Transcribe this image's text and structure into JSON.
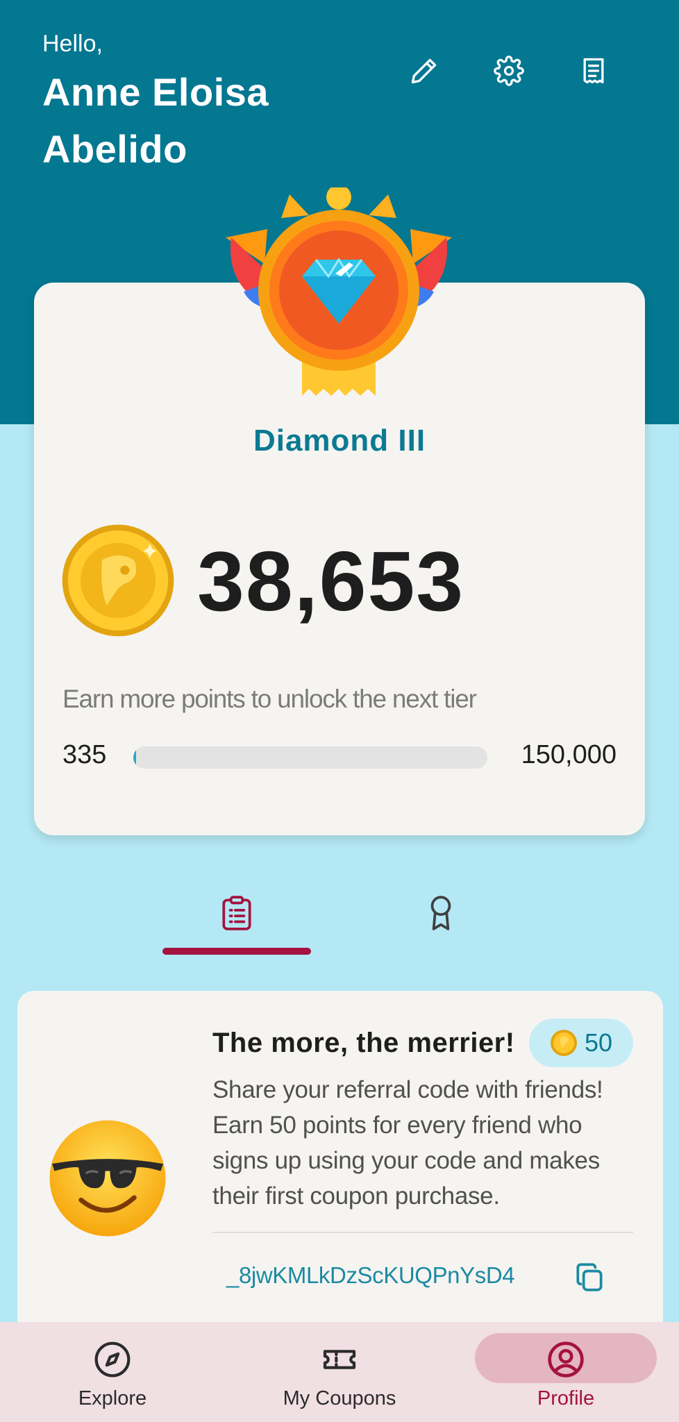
{
  "header": {
    "greeting": "Hello,",
    "user_name": "Anne Eloisa Abelido",
    "icons": [
      "pencil-icon",
      "gear-icon",
      "receipt-icon"
    ]
  },
  "points_card": {
    "tier_name": "Diamond III",
    "points": "38,653",
    "next_tier_text": "Earn more points to unlock the next tier",
    "progress_min": "335",
    "progress_max": "150,000",
    "progress_fraction": 0.002
  },
  "tabs": [
    {
      "icon": "clipboard-list-icon",
      "active": true
    },
    {
      "icon": "ribbon-award-icon",
      "active": false
    }
  ],
  "referral": {
    "title": "The more, the merrier!",
    "reward_points": "50",
    "description": "Share your referral code with friends! Earn 50 points for every friend who signs up using your code and makes their first coupon purchase.",
    "code": "_8jwKMLkDzScKUQPnYsD4"
  },
  "bottom_nav": {
    "items": [
      {
        "label": "Explore",
        "icon": "compass-icon"
      },
      {
        "label": "My Coupons",
        "icon": "ticket-icon"
      },
      {
        "label": "Profile",
        "icon": "user-circle-icon",
        "active": true
      }
    ]
  },
  "colors": {
    "header_bg": "#047791",
    "page_bg": "#b3e8f4",
    "card_bg": "#f6f4f1",
    "accent": "#a4123f",
    "teal_text": "#0b7a92"
  }
}
